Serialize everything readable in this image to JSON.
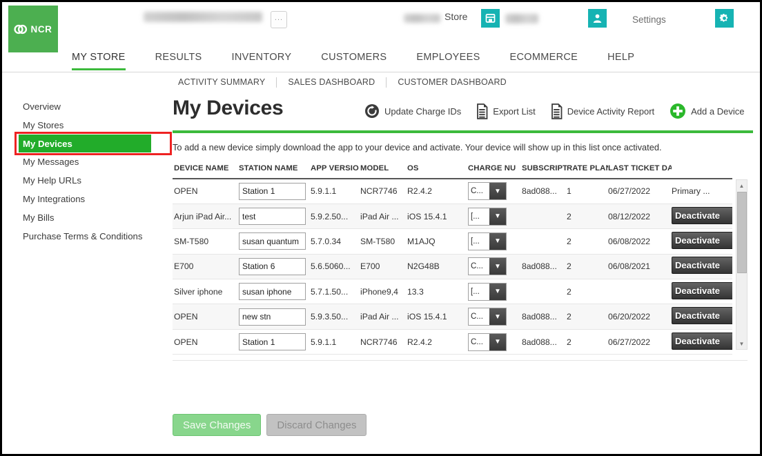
{
  "header": {
    "logo_text": "NCR",
    "store_label": "Store",
    "settings_label": "Settings",
    "dots_button": "...",
    "icons": {
      "store": "store-icon",
      "person": "person-icon",
      "gear": "gear-icon"
    }
  },
  "main_nav": {
    "items": [
      {
        "label": "MY STORE",
        "active": true
      },
      {
        "label": "RESULTS",
        "active": false
      },
      {
        "label": "INVENTORY",
        "active": false
      },
      {
        "label": "CUSTOMERS",
        "active": false
      },
      {
        "label": "EMPLOYEES",
        "active": false
      },
      {
        "label": "ECOMMERCE",
        "active": false
      },
      {
        "label": "HELP",
        "active": false
      }
    ]
  },
  "sub_nav": {
    "items": [
      {
        "label": "ACTIVITY SUMMARY"
      },
      {
        "label": "SALES DASHBOARD"
      },
      {
        "label": "CUSTOMER DASHBOARD"
      }
    ]
  },
  "sidebar": {
    "items": [
      {
        "label": "Overview",
        "active": false
      },
      {
        "label": "My Stores",
        "active": false
      },
      {
        "label": "My Devices",
        "active": true
      },
      {
        "label": "My Messages",
        "active": false
      },
      {
        "label": "My Help URLs",
        "active": false
      },
      {
        "label": "My Integrations",
        "active": false
      },
      {
        "label": "My Bills",
        "active": false
      },
      {
        "label": "Purchase Terms & Conditions",
        "active": false
      }
    ],
    "highlight_color": "#22ac2a",
    "annotation_color": "#ee2222"
  },
  "page": {
    "title": "My Devices",
    "intro": "To add a new device simply download the app to your device and activate. Your device will show up in this list once activated.",
    "accent_color": "#3cba3c"
  },
  "actions": [
    {
      "label": "Update Charge IDs",
      "icon": "refresh-circle-icon"
    },
    {
      "label": "Export List",
      "icon": "document-icon"
    },
    {
      "label": "Device Activity Report",
      "icon": "document-icon"
    },
    {
      "label": "Add a Device",
      "icon": "plus-circle-icon"
    }
  ],
  "table": {
    "columns": [
      "DEVICE NAME",
      "STATION NAME",
      "APP VERSIO",
      "MODEL",
      "OS",
      "CHARGE NU",
      "SUBSCRIPTI",
      "RATE PLAN",
      "LAST TICKET DAT",
      ""
    ],
    "rows": [
      {
        "device_name": "OPEN",
        "station_name": "Station 1",
        "app_version": "5.9.1.1",
        "model": "NCR7746",
        "os": "R2.4.2",
        "charge_number": "C...",
        "subscription": "8ad088...",
        "rate_plan": "1",
        "last_ticket_date": "06/27/2022",
        "action": "Primary ...",
        "action_type": "text"
      },
      {
        "device_name": "Arjun iPad Air...",
        "station_name": "test",
        "app_version": "5.9.2.50...",
        "model": "iPad Air ...",
        "os": "iOS 15.4.1",
        "charge_number": "[...",
        "subscription": "",
        "rate_plan": "2",
        "last_ticket_date": "08/12/2022",
        "action": "Deactivate",
        "action_type": "button"
      },
      {
        "device_name": "SM-T580",
        "station_name": "susan quantum",
        "app_version": "5.7.0.34",
        "model": "SM-T580",
        "os": "M1AJQ",
        "charge_number": "[...",
        "subscription": "",
        "rate_plan": "2",
        "last_ticket_date": "06/08/2022",
        "action": "Deactivate",
        "action_type": "button"
      },
      {
        "device_name": "E700",
        "station_name": "Station 6",
        "app_version": "5.6.5060...",
        "model": "E700",
        "os": "N2G48B",
        "charge_number": "C...",
        "subscription": "8ad088...",
        "rate_plan": "2",
        "last_ticket_date": "06/08/2021",
        "action": "Deactivate",
        "action_type": "button"
      },
      {
        "device_name": "Silver iphone",
        "station_name": "susan iphone",
        "app_version": "5.7.1.50...",
        "model": "iPhone9,4",
        "os": "13.3",
        "charge_number": "[...",
        "subscription": "",
        "rate_plan": "2",
        "last_ticket_date": "",
        "action": "Deactivate",
        "action_type": "button"
      },
      {
        "device_name": "OPEN",
        "station_name": "new stn",
        "app_version": "5.9.3.50...",
        "model": "iPad Air ...",
        "os": "iOS 15.4.1",
        "charge_number": "C...",
        "subscription": "8ad088...",
        "rate_plan": "2",
        "last_ticket_date": "06/20/2022",
        "action": "Deactivate",
        "action_type": "button"
      },
      {
        "device_name": "OPEN",
        "station_name": "Station 1",
        "app_version": "5.9.1.1",
        "model": "NCR7746",
        "os": "R2.4.2",
        "charge_number": "C...",
        "subscription": "8ad088...",
        "rate_plan": "2",
        "last_ticket_date": "06/27/2022",
        "action": "Deactivate",
        "action_type": "button"
      }
    ]
  },
  "footer": {
    "save_label": "Save Changes",
    "discard_label": "Discard Changes"
  }
}
